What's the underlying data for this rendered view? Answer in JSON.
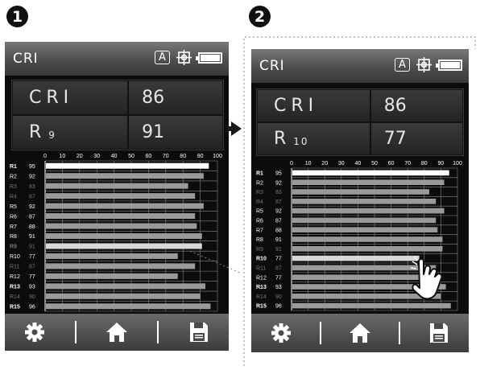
{
  "steps": [
    "1",
    "2"
  ],
  "screens": [
    {
      "title": "CRI",
      "icon_a": "A",
      "icons": [
        "a-mode-icon",
        "target-icon",
        "battery-icon"
      ],
      "readout": {
        "label1": "CRI",
        "value1": "86",
        "label2_main": "R",
        "label2_sub": "9",
        "value2": "91"
      },
      "highlight_index": 8,
      "bottom": [
        "gear-icon",
        "home-icon",
        "save-icon"
      ]
    },
    {
      "title": "CRI",
      "icon_a": "A",
      "icons": [
        "a-mode-icon",
        "target-icon",
        "battery-icon"
      ],
      "readout": {
        "label1": "CRI",
        "value1": "86",
        "label2_main": "R",
        "label2_sub": "10",
        "value2": "77"
      },
      "highlight_index": 9,
      "bottom": [
        "gear-icon",
        "home-icon",
        "save-icon"
      ]
    }
  ],
  "chart_data": {
    "type": "bar",
    "orientation": "horizontal",
    "categories": [
      "R1",
      "R2",
      "R3",
      "R4",
      "R5",
      "R6",
      "R7",
      "R8",
      "R9",
      "R10",
      "R11",
      "R12",
      "R13",
      "R14",
      "R15"
    ],
    "values": [
      95,
      92,
      83,
      87,
      92,
      87,
      88,
      91,
      91,
      77,
      87,
      77,
      93,
      90,
      96
    ],
    "xlim": [
      0,
      100
    ],
    "xticks": [
      0,
      10,
      20,
      30,
      40,
      50,
      60,
      70,
      80,
      90,
      100
    ],
    "grid": true
  }
}
